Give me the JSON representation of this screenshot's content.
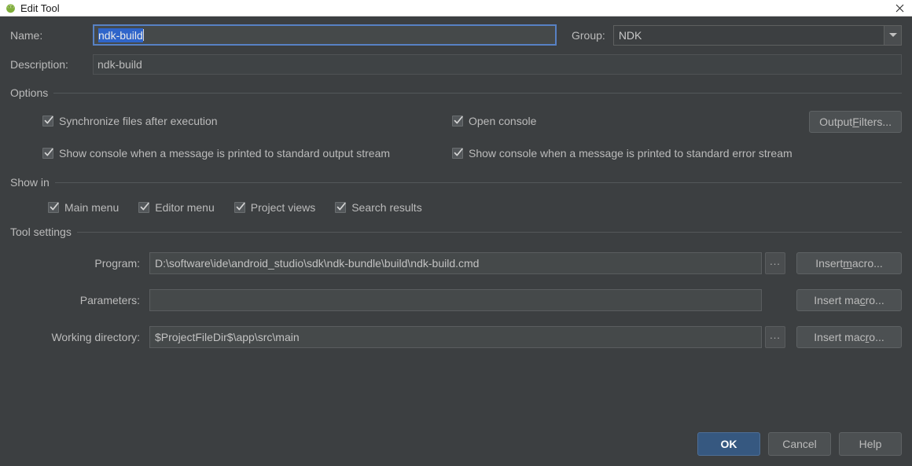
{
  "window": {
    "title": "Edit Tool",
    "icon": "android-head-icon",
    "close_label": "✕"
  },
  "form": {
    "name_label": "Name:",
    "name_value": "ndk-build",
    "name_selected": true,
    "group_label": "Group:",
    "group_value": "NDK",
    "description_label": "Description:",
    "description_value": "ndk-build"
  },
  "options": {
    "title": "Options",
    "checkboxes": [
      {
        "label": "Synchronize files after execution",
        "checked": true
      },
      {
        "label": "Open console",
        "checked": true
      },
      {
        "label": "Show console when a message is printed to standard output stream",
        "checked": true
      },
      {
        "label": "Show console when a message is printed to standard error stream",
        "checked": true
      }
    ],
    "output_filters_button": {
      "prefix": "Output ",
      "mnemonic": "F",
      "suffix": "ilters..."
    }
  },
  "show_in": {
    "title": "Show in",
    "checkboxes": [
      {
        "label": "Main menu",
        "checked": true
      },
      {
        "label": "Editor menu",
        "checked": true
      },
      {
        "label": "Project views",
        "checked": true
      },
      {
        "label": "Search results",
        "checked": true
      }
    ]
  },
  "tool_settings": {
    "title": "Tool settings",
    "rows": [
      {
        "label": "Program:",
        "value": "D:\\software\\ide\\android_studio\\sdk\\ndk-bundle\\build\\ndk-build.cmd",
        "has_browse": true,
        "browse_label": "...",
        "macro_button": {
          "prefix": "Insert ",
          "mnemonic": "m",
          "suffix": "acro..."
        }
      },
      {
        "label": "Parameters:",
        "value": "",
        "has_browse": false,
        "browse_label": "",
        "macro_button": {
          "prefix": "Insert ma",
          "mnemonic": "c",
          "suffix": "ro..."
        }
      },
      {
        "label": "Working directory:",
        "value": "$ProjectFileDir$\\app\\src\\main",
        "has_browse": true,
        "browse_label": "...",
        "macro_button": {
          "prefix": "Insert mac",
          "mnemonic": "r",
          "suffix": "o..."
        }
      }
    ]
  },
  "footer": {
    "ok": "OK",
    "cancel": "Cancel",
    "help": "Help"
  },
  "colors": {
    "dialog_bg": "#3c3f41",
    "field_bg": "#45494a",
    "text": "#bbbbbb",
    "selection": "#2f65ca",
    "focus_border": "#5781c4",
    "default_button": "#365880",
    "titlebar_bg": "#ffffff",
    "titlebar_text": "#1a1a1a",
    "icon_green": "#7fae3a"
  }
}
